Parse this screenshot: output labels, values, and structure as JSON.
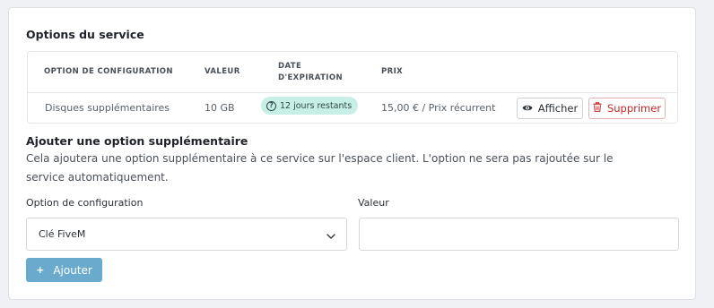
{
  "service_options": {
    "title": "Options du service",
    "columns": {
      "config": "OPTION DE CONFIGURATION",
      "value": "VALEUR",
      "expiration_line1": "DATE",
      "expiration_line2": "D'EXPIRATION",
      "price": "PRIX"
    },
    "rows": [
      {
        "config": "Disques supplémentaires",
        "value": "10 GB",
        "expiration": "12 jours restants",
        "price": "15,00 € / Prix récurrent",
        "view_label": "Afficher",
        "delete_label": "Supprimer"
      }
    ]
  },
  "add_option": {
    "title": "Ajouter une option supplémentaire",
    "description": "Cela ajoutera une option supplémentaire à ce service sur l'espace client. L'option ne sera pas rajoutée sur le service automatiquement.",
    "config_label": "Option de configuration",
    "config_selected": "Clé FiveM",
    "value_label": "Valeur",
    "value_input": "",
    "submit_label": "Ajouter"
  },
  "colors": {
    "badge_bg": "#c8efe6",
    "delete": "#c0282b",
    "primary_button": "#6aaacc"
  },
  "icons": {
    "badge": "question-circle-icon",
    "view": "eye-icon",
    "delete": "trash-icon",
    "select": "chevron-down-icon",
    "add": "plus-icon"
  }
}
